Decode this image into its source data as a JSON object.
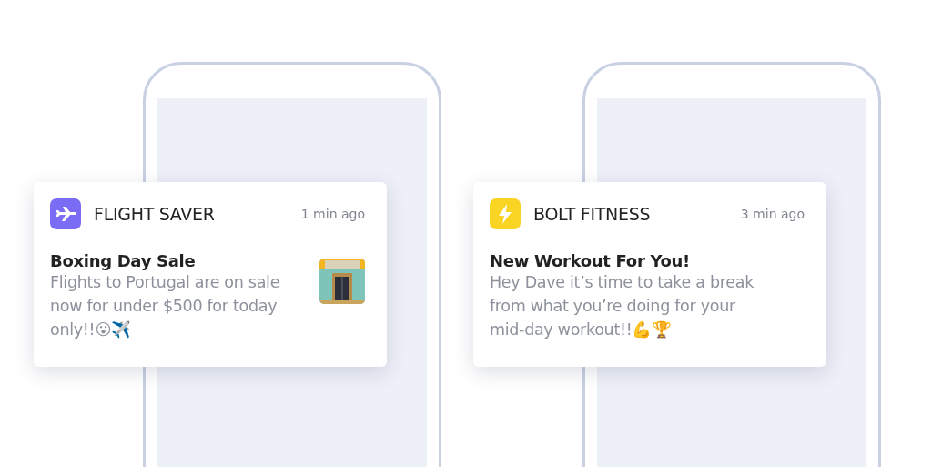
{
  "notifications": [
    {
      "app": "FLIGHT SAVER",
      "kind": "plane",
      "color": "#7b6cf6",
      "time": "1 min ago",
      "title": "Boxing Day Sale",
      "body": "Flights to Portugal are on sale now for under $500 for today only!!😮✈️"
    },
    {
      "app": "BOLT FITNESS",
      "kind": "bolt",
      "color": "#f9d423",
      "time": "3 min ago",
      "title": "New Workout For You!",
      "body": "Hey Dave it’s time to take a break from what you’re doing for your mid-day workout!!💪🏆"
    }
  ]
}
